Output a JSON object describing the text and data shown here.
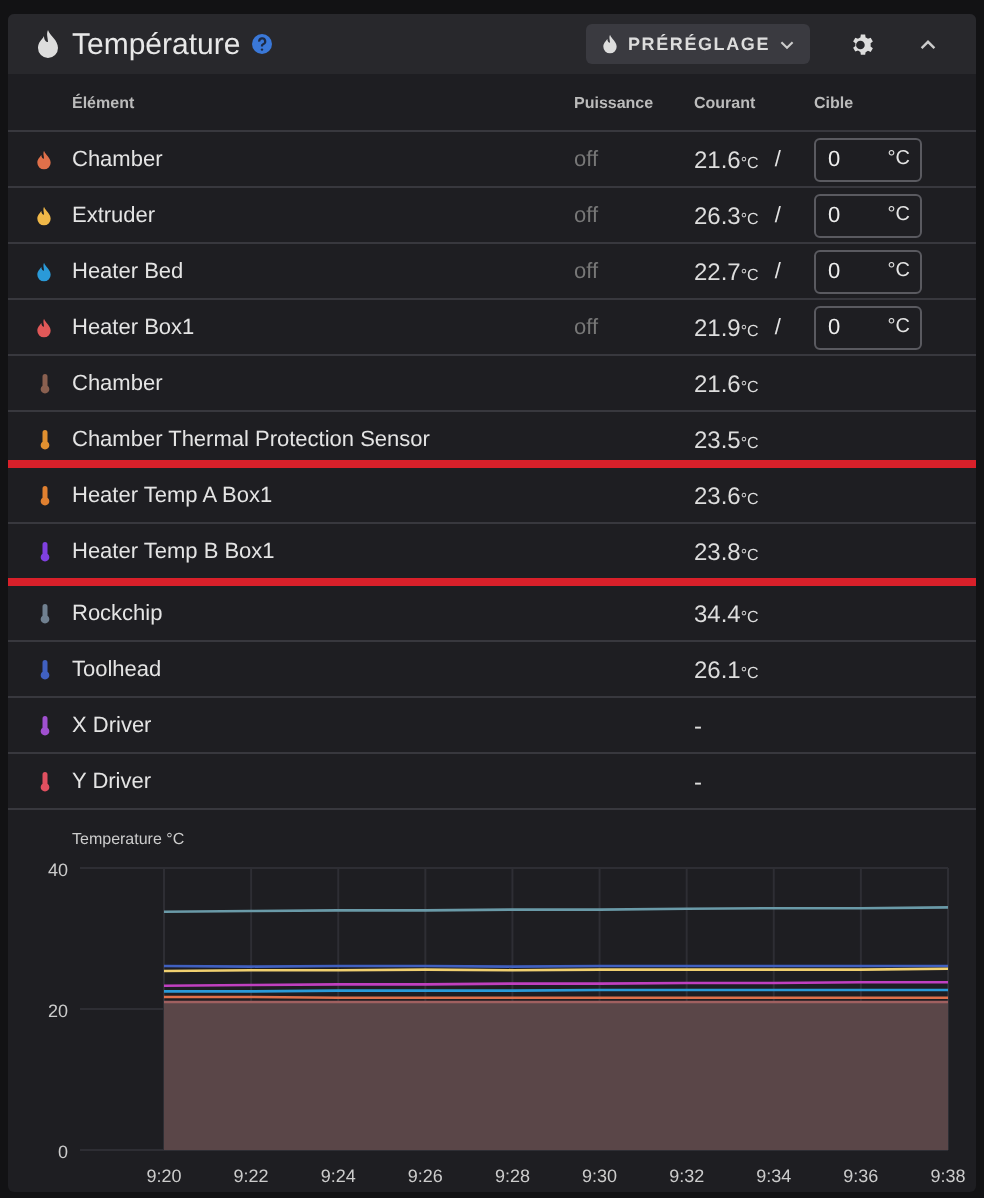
{
  "panel": {
    "title": "Température",
    "preset_button": "PRÉRÉGLAGE"
  },
  "table": {
    "columns": [
      "Élément",
      "Puissance",
      "Courant",
      "Cible"
    ],
    "rows": [
      {
        "kind": "heater",
        "name": "Chamber",
        "color": "#e0704a",
        "power": "off",
        "current": "21.6",
        "unit": "°C",
        "separator": "/",
        "target": "0",
        "target_unit": "°C",
        "highlighted": false
      },
      {
        "kind": "heater",
        "name": "Extruder",
        "color": "#f0b848",
        "power": "off",
        "current": "26.3",
        "unit": "°C",
        "separator": "/",
        "target": "0",
        "target_unit": "°C",
        "highlighted": false
      },
      {
        "kind": "heater",
        "name": "Heater Bed",
        "color": "#2a9ad8",
        "power": "off",
        "current": "22.7",
        "unit": "°C",
        "separator": "/",
        "target": "0",
        "target_unit": "°C",
        "highlighted": false
      },
      {
        "kind": "heater",
        "name": "Heater Box1",
        "color": "#e05858",
        "power": "off",
        "current": "21.9",
        "unit": "°C",
        "separator": "/",
        "target": "0",
        "target_unit": "°C",
        "highlighted": false
      },
      {
        "kind": "sensor",
        "name": "Chamber",
        "color": "#8a6050",
        "current": "21.6",
        "unit": "°C",
        "highlighted": false
      },
      {
        "kind": "sensor",
        "name": "Chamber Thermal Protection Sensor",
        "color": "#e09030",
        "current": "23.5",
        "unit": "°C",
        "highlighted": false
      },
      {
        "kind": "sensor",
        "name": "Heater Temp A Box1",
        "color": "#e08030",
        "current": "23.6",
        "unit": "°C",
        "highlighted": true
      },
      {
        "kind": "sensor",
        "name": "Heater Temp B Box1",
        "color": "#8040e0",
        "current": "23.8",
        "unit": "°C",
        "highlighted": true
      },
      {
        "kind": "sensor",
        "name": "Rockchip",
        "color": "#708090",
        "current": "34.4",
        "unit": "°C",
        "highlighted": false
      },
      {
        "kind": "sensor",
        "name": "Toolhead",
        "color": "#4060c0",
        "current": "26.1",
        "unit": "°C",
        "highlighted": false
      },
      {
        "kind": "sensor",
        "name": "X Driver",
        "color": "#a050d0",
        "current": "-",
        "highlighted": false
      },
      {
        "kind": "sensor",
        "name": "Y Driver",
        "color": "#e05060",
        "current": "-",
        "highlighted": false
      }
    ]
  },
  "chart": {
    "chart_data": {
      "type": "line",
      "ylabel": "Temperature °C",
      "categories": [
        "9:20",
        "9:22",
        "9:24",
        "9:26",
        "9:28",
        "9:30",
        "9:32",
        "9:34",
        "9:36",
        "9:38"
      ],
      "ylim": [
        0,
        40
      ],
      "grid": true,
      "yticks": [
        0,
        20,
        40
      ],
      "series": [
        {
          "color": "#a06060",
          "values": [
            21.0,
            21.0,
            21.0,
            21.0,
            21.0,
            21.0,
            21.0,
            21.0,
            21.0,
            21.0
          ]
        },
        {
          "color": "#e0704a",
          "values": [
            21.7,
            21.7,
            21.6,
            21.6,
            21.6,
            21.6,
            21.6,
            21.6,
            21.6,
            21.6
          ]
        },
        {
          "color": "#2a9ad8",
          "values": [
            22.5,
            22.5,
            22.6,
            22.6,
            22.6,
            22.7,
            22.7,
            22.7,
            22.7,
            22.7
          ]
        },
        {
          "color": "#c040c0",
          "values": [
            23.3,
            23.4,
            23.5,
            23.5,
            23.6,
            23.6,
            23.7,
            23.7,
            23.8,
            23.8
          ]
        },
        {
          "color": "#4060c0",
          "values": [
            26.1,
            26.0,
            26.1,
            26.1,
            26.0,
            26.1,
            26.1,
            26.1,
            26.1,
            26.1
          ]
        },
        {
          "color": "#f0d070",
          "values": [
            25.4,
            25.5,
            25.5,
            25.6,
            25.5,
            25.6,
            25.6,
            25.6,
            25.6,
            25.7
          ]
        },
        {
          "color": "#6a9aa8",
          "values": [
            33.8,
            33.9,
            34.0,
            34.0,
            34.1,
            34.1,
            34.2,
            34.3,
            34.3,
            34.4
          ]
        }
      ]
    }
  }
}
